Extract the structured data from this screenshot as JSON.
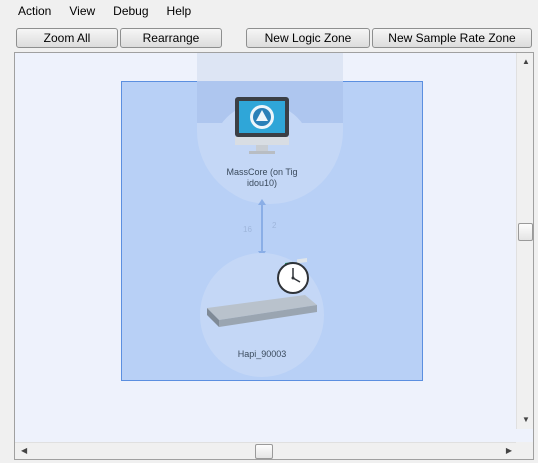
{
  "menu": [
    "Action",
    "View",
    "Debug",
    "Help"
  ],
  "toolbar": {
    "zoom_all": "Zoom All",
    "rearrange": "Rearrange",
    "new_logic_zone": "New Logic Zone",
    "new_sample_rate_zone": "New Sample Rate Zone"
  },
  "nodes": {
    "masscore": {
      "label_line1": "MassCore (on Tig",
      "label_line2": "idou10)",
      "icon": "monitor-icon"
    },
    "hapi": {
      "label": "Hapi_90003",
      "icon": "audio-device-icon",
      "clock_icon": "clock-icon"
    }
  },
  "connection": {
    "left_label": "16",
    "right_label": "2"
  },
  "colors": {
    "zone_fill": "#b8d0f6",
    "zone_border": "#5b8fe0",
    "canvas_bg": "#eef2fc",
    "node_circle": "#c9daf6"
  }
}
